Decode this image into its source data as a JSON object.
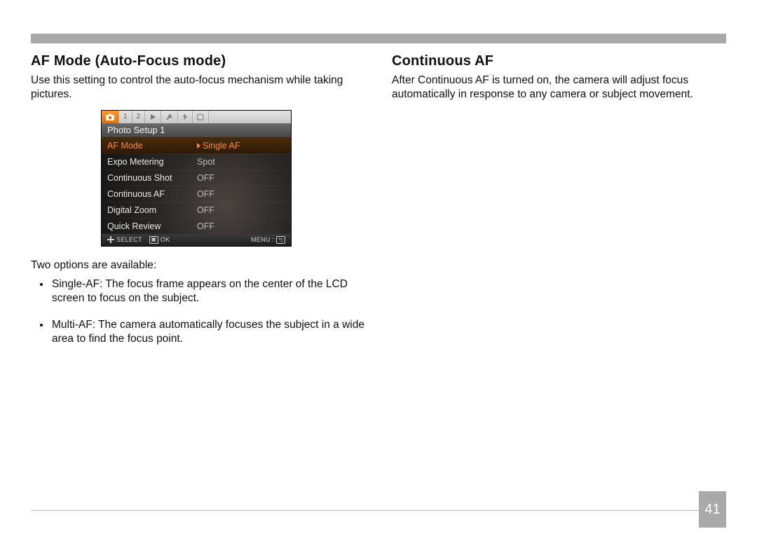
{
  "page_number": "41",
  "left": {
    "heading": "AF Mode (Auto-Focus mode)",
    "intro": "Use this setting to control the auto-focus mechanism while taking pictures.",
    "options_lead": "Two options are available:",
    "options": [
      "Single-AF: The focus frame appears on the center of the LCD screen to focus on the subject.",
      "Multi-AF: The camera automatically focuses the subject in a wide area to find the focus point."
    ]
  },
  "right": {
    "heading": "Continuous AF",
    "intro": "After Continuous AF is turned on, the camera will adjust focus automatically in response to any camera or subject movement."
  },
  "camera_menu": {
    "tabs": [
      "camera-icon",
      "1",
      "2",
      "play-icon",
      "wrench-icon",
      "flash-icon",
      "sd-icon"
    ],
    "active_tab_index": 0,
    "subtitle": "Photo Setup 1",
    "rows": [
      {
        "label": "AF Mode",
        "value": "Single AF",
        "selected": true
      },
      {
        "label": "Expo Metering",
        "value": "Spot",
        "selected": false
      },
      {
        "label": "Continuous Shot",
        "value": "OFF",
        "selected": false
      },
      {
        "label": "Continuous AF",
        "value": "OFF",
        "selected": false
      },
      {
        "label": "Digital Zoom",
        "value": "OFF",
        "selected": false
      },
      {
        "label": "Quick Review",
        "value": "OFF",
        "selected": false
      }
    ],
    "footer": {
      "select": "SELECT",
      "ok": "OK",
      "menu": "MENU :",
      "exit_icon": "exit-icon"
    }
  }
}
